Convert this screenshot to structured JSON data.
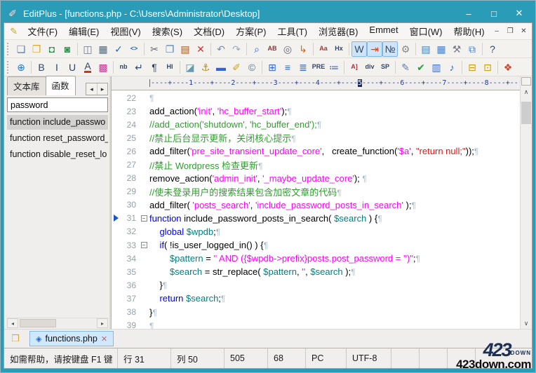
{
  "window": {
    "title": "EditPlus - [functions.php - C:\\Users\\Administrator\\Desktop]",
    "app_icon": "✐",
    "controls": {
      "minimize": "–",
      "maximize": "□",
      "close": "✕"
    }
  },
  "menu": {
    "mdi_icon": "✎",
    "items": [
      "文件(F)",
      "编辑(E)",
      "视图(V)",
      "搜索(S)",
      "文档(D)",
      "方案(P)",
      "工具(T)",
      "浏览器(B)",
      "Emmet",
      "窗口(W)",
      "帮助(H)"
    ],
    "window_buttons": {
      "minimize": "–",
      "restore": "❐",
      "close": "✕"
    }
  },
  "toolbars": {
    "main": [
      {
        "name": "new-file",
        "glyph": "❏",
        "color": "#5b7fb4"
      },
      {
        "name": "open-file",
        "glyph": "❒",
        "color": "#d9a63a"
      },
      {
        "name": "save",
        "glyph": "◘",
        "color": "#2f8f4f"
      },
      {
        "name": "save-all",
        "glyph": "◙",
        "color": "#2f8f4f"
      },
      {
        "sep": true
      },
      {
        "name": "print-preview",
        "glyph": "◫",
        "color": "#667788"
      },
      {
        "name": "print",
        "glyph": "▦",
        "color": "#556677"
      },
      {
        "name": "spell-check",
        "glyph": "✓",
        "color": "#2266cc"
      },
      {
        "name": "html-tags",
        "glyph": "<>",
        "color": "#2266cc"
      },
      {
        "sep": true
      },
      {
        "name": "cut",
        "glyph": "✂",
        "color": "#666677"
      },
      {
        "name": "copy",
        "glyph": "❐",
        "color": "#5b7fb4"
      },
      {
        "name": "paste",
        "glyph": "▤",
        "color": "#a05a2c"
      },
      {
        "name": "delete",
        "glyph": "✕",
        "color": "#cc3333"
      },
      {
        "sep": true
      },
      {
        "name": "undo",
        "glyph": "↶",
        "color": "#7a8aa8"
      },
      {
        "name": "redo",
        "glyph": "↷",
        "color": "#9aa8c0"
      },
      {
        "sep": true
      },
      {
        "name": "find",
        "glyph": "⌕",
        "color": "#2266cc"
      },
      {
        "name": "replace",
        "glyph": "AB",
        "color": "#8b3333"
      },
      {
        "name": "find-in-files",
        "glyph": "◎",
        "color": "#666677"
      },
      {
        "name": "goto-line",
        "glyph": "↳",
        "color": "#cc6622"
      },
      {
        "sep": true
      },
      {
        "name": "set-font",
        "glyph": "Aa",
        "color": "#aa3333"
      },
      {
        "name": "hex-viewer",
        "glyph": "Hx",
        "color": "#334466"
      },
      {
        "sep": true
      },
      {
        "name": "word-wrap",
        "glyph": "W",
        "color": "#334466",
        "pressed": true
      },
      {
        "name": "indent-guide",
        "glyph": "⇥",
        "color": "#cc4422",
        "pressed": true
      },
      {
        "name": "line-numbers",
        "glyph": "№",
        "color": "#334466",
        "pressed": true
      },
      {
        "name": "preferences",
        "glyph": "⚙",
        "color": "#888888"
      },
      {
        "sep": true
      },
      {
        "name": "document-selector",
        "glyph": "▤",
        "color": "#4a7dc0"
      },
      {
        "name": "document-tabs",
        "glyph": "▦",
        "color": "#4a7dc0"
      },
      {
        "name": "user-tools",
        "glyph": "⚒",
        "color": "#777788"
      },
      {
        "name": "open-in-window",
        "glyph": "⧉",
        "color": "#4a7dc0"
      },
      {
        "sep": true
      },
      {
        "name": "context-help",
        "glyph": "?",
        "color": "#334466"
      }
    ],
    "format": [
      {
        "name": "browser-preview",
        "glyph": "⊕",
        "color": "#2277bb"
      },
      {
        "sep": true
      },
      {
        "name": "bold",
        "glyph": "B",
        "color": "#334466"
      },
      {
        "name": "italic",
        "glyph": "I",
        "color": "#334466"
      },
      {
        "name": "underline",
        "glyph": "U",
        "color": "#334466"
      },
      {
        "name": "font-color",
        "glyph": "A",
        "color": "#334466",
        "bar": "#e03000"
      },
      {
        "name": "color-palette",
        "glyph": "▩",
        "color": "#cc3399"
      },
      {
        "sep": true
      },
      {
        "name": "non-breaking-space",
        "glyph": "nb",
        "color": "#334466"
      },
      {
        "name": "line-break",
        "glyph": "↵",
        "color": "#334466"
      },
      {
        "name": "paragraph-tag",
        "glyph": "¶",
        "color": "#334466"
      },
      {
        "name": "heading-tag",
        "glyph": "HI",
        "color": "#334466"
      },
      {
        "sep": true
      },
      {
        "name": "insert-image",
        "glyph": "◪",
        "color": "#6699aa"
      },
      {
        "name": "insert-anchor",
        "glyph": "⚓",
        "color": "#b8860b"
      },
      {
        "name": "horizontal-rule",
        "glyph": "▬",
        "color": "#3366cc"
      },
      {
        "name": "insert-note",
        "glyph": "✐",
        "color": "#c9a227"
      },
      {
        "name": "special-character",
        "glyph": "©",
        "color": "#667788"
      },
      {
        "sep": true
      },
      {
        "name": "insert-table",
        "glyph": "⊞",
        "color": "#3366cc"
      },
      {
        "name": "align-left",
        "glyph": "≡",
        "color": "#3366cc"
      },
      {
        "name": "align-center",
        "glyph": "≣",
        "color": "#3366cc"
      },
      {
        "name": "pre-tag",
        "glyph": "PRE",
        "color": "#334466"
      },
      {
        "name": "list-tag",
        "glyph": "≔",
        "color": "#3366cc"
      },
      {
        "sep": true
      },
      {
        "name": "anchor-text",
        "glyph": "A]",
        "color": "#aa3333"
      },
      {
        "name": "div-tag",
        "glyph": "div",
        "color": "#334466"
      },
      {
        "name": "span-tag",
        "glyph": "SP",
        "color": "#334466"
      },
      {
        "sep": true
      },
      {
        "name": "edit-script",
        "glyph": "✎",
        "color": "#5b7fb4"
      },
      {
        "name": "syntax-check",
        "glyph": "✔",
        "color": "#2a9a44"
      },
      {
        "name": "insert-media",
        "glyph": "▥",
        "color": "#3366cc"
      },
      {
        "name": "insert-audio",
        "glyph": "♪",
        "color": "#3366cc"
      },
      {
        "sep": true
      },
      {
        "name": "form-listbox",
        "glyph": "⊟",
        "color": "#cc9900"
      },
      {
        "name": "form-radio",
        "glyph": "⊡",
        "color": "#cc9900"
      },
      {
        "sep": true
      },
      {
        "name": "web-colors",
        "glyph": "❖",
        "color": "#d04428"
      }
    ]
  },
  "sidebar": {
    "tabs": [
      {
        "label": "文本库"
      },
      {
        "label": "函数"
      }
    ],
    "active_tab": 1,
    "scroll_left": "◂",
    "scroll_right": "▸",
    "search_value": "password",
    "selected": 0,
    "items": [
      "function include_passwo",
      "function reset_password_",
      "function disable_reset_lo"
    ]
  },
  "editor": {
    "ruler": {
      "pre": "----+----1----+----2----+----3----+----4----+----",
      "cursor": "5",
      "post": "----+----6----+----7----+----8----+--"
    },
    "pilcrow": "¶",
    "fold_glyph": "−",
    "lines": [
      {
        "num": 22,
        "segments": []
      },
      {
        "num": 23,
        "segments": [
          [
            "add_action(",
            "p"
          ],
          [
            "'init'",
            "s"
          ],
          [
            ", ",
            "p"
          ],
          [
            "'hc_buffer_start'",
            "s"
          ],
          [
            ");",
            "p"
          ]
        ]
      },
      {
        "num": 24,
        "segments": [
          [
            "//add_action('shutdown', 'hc_buffer_end');",
            "c"
          ]
        ]
      },
      {
        "num": 25,
        "segments": [
          [
            "//禁止后台显示更新，关闭核心提示",
            "c"
          ]
        ]
      },
      {
        "num": 26,
        "segments": [
          [
            "add_filter(",
            "p"
          ],
          [
            "'pre_site_transient_update_core'",
            "s"
          ],
          [
            ",   create_function(",
            "p"
          ],
          [
            "'$a'",
            "s"
          ],
          [
            ", ",
            "p"
          ],
          [
            "\"return null;\"",
            "r"
          ],
          [
            "));",
            "p"
          ]
        ]
      },
      {
        "num": 27,
        "segments": [
          [
            "//禁止 Wordpress 检查更新",
            "c"
          ]
        ]
      },
      {
        "num": 28,
        "segments": [
          [
            "remove_action(",
            "p"
          ],
          [
            "'admin_init'",
            "s"
          ],
          [
            ", ",
            "p"
          ],
          [
            "'_maybe_update_core'",
            "s"
          ],
          [
            "); ",
            "p"
          ]
        ]
      },
      {
        "num": 29,
        "segments": [
          [
            "//使未登录用户的搜索结果包含加密文章的代码",
            "c"
          ]
        ]
      },
      {
        "num": 30,
        "segments": [
          [
            "add_filter( ",
            "p"
          ],
          [
            "'posts_search'",
            "s"
          ],
          [
            ", ",
            "p"
          ],
          [
            "'include_password_posts_in_search'",
            "s"
          ],
          [
            " );",
            "p"
          ]
        ]
      },
      {
        "num": 31,
        "marker": true,
        "fold": true,
        "segments": [
          [
            "function",
            "k"
          ],
          [
            " include_password_posts_in_search( ",
            "p"
          ],
          [
            "$search",
            "v"
          ],
          [
            " ) {",
            "p"
          ]
        ]
      },
      {
        "num": 32,
        "segments": [
          [
            "    ",
            "p"
          ],
          [
            "global",
            "k"
          ],
          [
            " ",
            "p"
          ],
          [
            "$wpdb",
            "v"
          ],
          [
            ";",
            "p"
          ]
        ]
      },
      {
        "num": 33,
        "fold": true,
        "segments": [
          [
            "    ",
            "p"
          ],
          [
            "if",
            "k"
          ],
          [
            "( !is_user_logged_in() ) {",
            "p"
          ]
        ]
      },
      {
        "num": 34,
        "segments": [
          [
            "        ",
            "p"
          ],
          [
            "$pattern",
            "v"
          ],
          [
            " = ",
            "p"
          ],
          [
            "\" AND ({$wpdb->prefix}posts.post_password = '')\"",
            "s"
          ],
          [
            ";",
            "p"
          ]
        ]
      },
      {
        "num": 35,
        "segments": [
          [
            "        ",
            "p"
          ],
          [
            "$search",
            "v"
          ],
          [
            " = str_replace( ",
            "p"
          ],
          [
            "$pattern",
            "v"
          ],
          [
            ", ",
            "p"
          ],
          [
            "''",
            "s"
          ],
          [
            ", ",
            "p"
          ],
          [
            "$search",
            "v"
          ],
          [
            " );",
            "p"
          ]
        ]
      },
      {
        "num": 36,
        "segments": [
          [
            "    }",
            "p"
          ]
        ]
      },
      {
        "num": 37,
        "segments": [
          [
            "    ",
            "p"
          ],
          [
            "return",
            "k"
          ],
          [
            " ",
            "p"
          ],
          [
            "$search",
            "v"
          ],
          [
            ";",
            "p"
          ]
        ]
      },
      {
        "num": 38,
        "segments": [
          [
            "}",
            "p"
          ]
        ]
      },
      {
        "num": 39,
        "segments": []
      }
    ],
    "vscroll": {
      "up": "∧",
      "down": "∨"
    },
    "hscroll": {
      "left": "◂",
      "right": "▸"
    }
  },
  "doc_tabs": {
    "folder_icon": "❒",
    "active": {
      "diamond": "◈",
      "label": "functions.php",
      "close": "✕"
    }
  },
  "status": {
    "cells": [
      "如需帮助，请按键盘 F1 键",
      "行 31",
      "列 50",
      "505",
      "68",
      "PC",
      "UTF-8",
      "",
      "",
      ""
    ]
  },
  "watermark": {
    "logo": "423",
    "logo_sub": "DOWN",
    "site": "423down.com"
  }
}
